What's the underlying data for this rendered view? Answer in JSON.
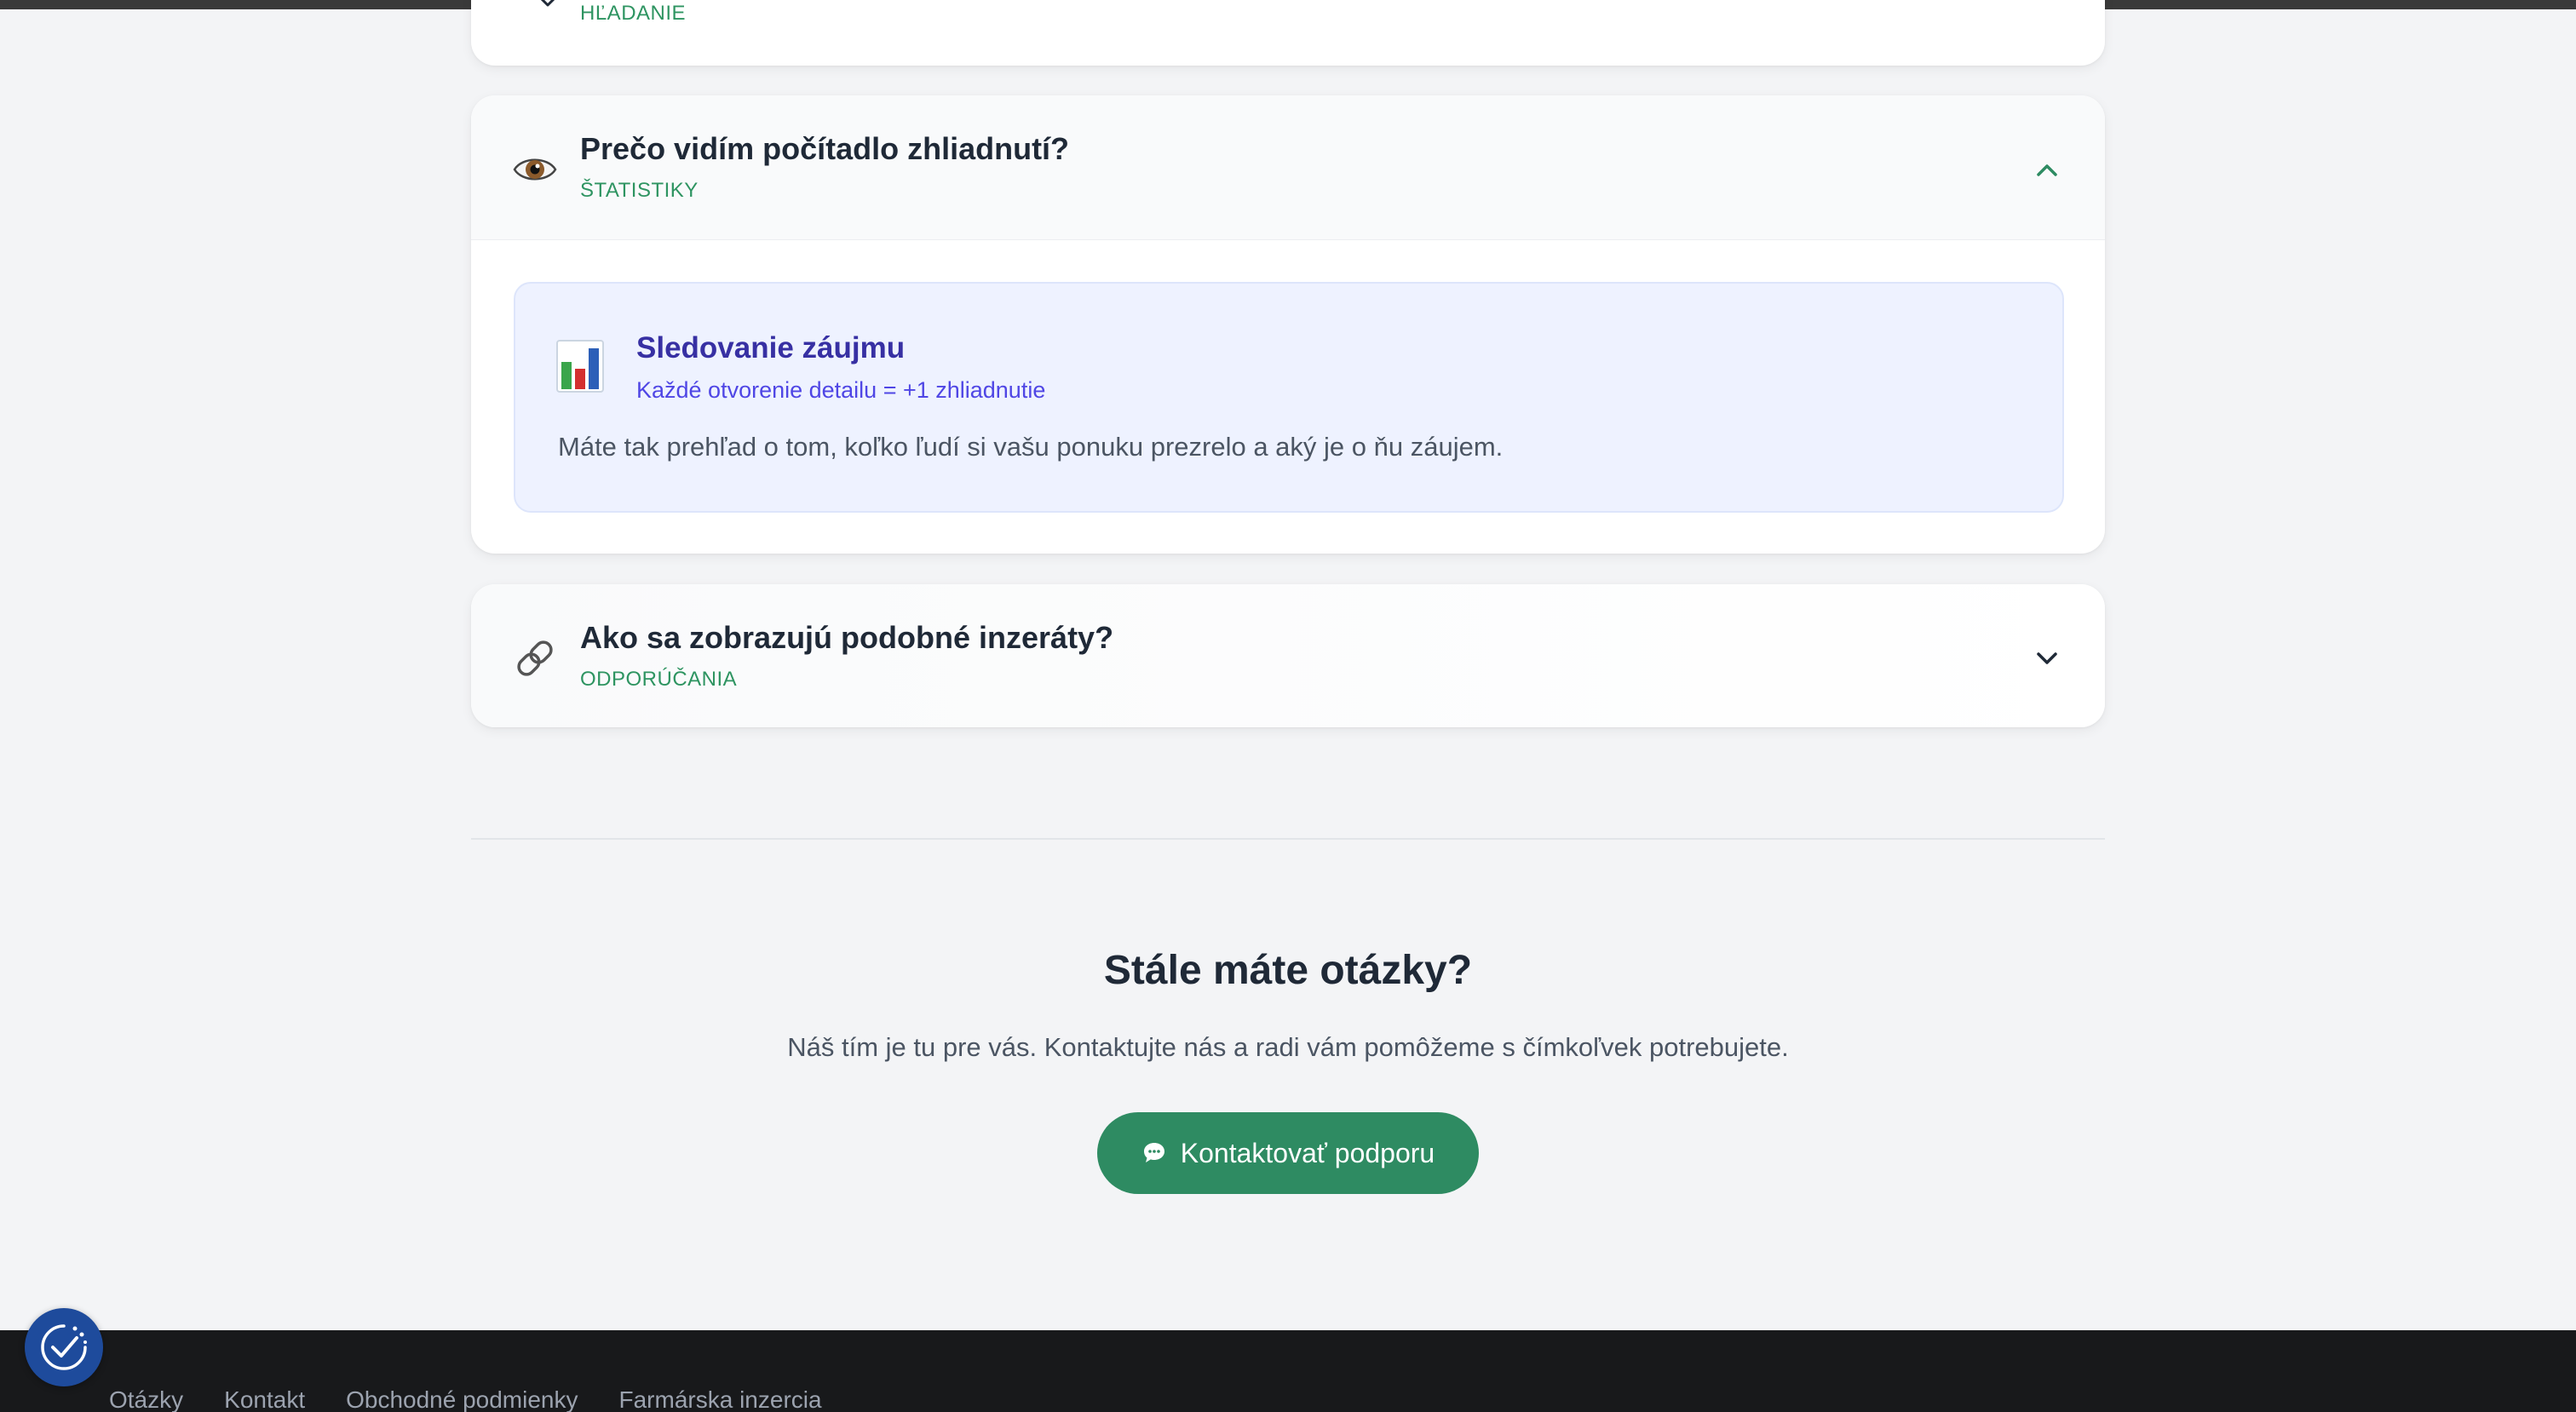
{
  "faq": {
    "previous": {
      "category": "HĽADANIE"
    },
    "open": {
      "question": "Prečo vidím počítadlo zhliadnutí?",
      "category": "ŠTATISTIKY",
      "icon": "eye-icon",
      "answer": {
        "icon": "bar-chart-icon",
        "title": "Sledovanie záujmu",
        "subtitle": "Každé otvorenie detailu = +1 zhliadnutie",
        "text": "Máte tak prehľad o tom, koľko ľudí si vašu ponuku prezrelo a aký je o ňu záujem."
      }
    },
    "closed": {
      "question": "Ako sa zobrazujú podobné inzeráty?",
      "category": "ODPORÚČANIA",
      "icon": "link-icon"
    }
  },
  "cta": {
    "title": "Stále máte otázky?",
    "text": "Náš tím je tu pre vás. Kontaktujte nás a radi vám pomôžeme s čímkoľvek potrebujete.",
    "button_label": "Kontaktovať podporu",
    "button_icon": "speech-bubble-icon"
  },
  "footer": {
    "links": [
      "Otázky",
      "Kontakt",
      "Obchodné podmienky",
      "Farmárska inzercia"
    ]
  },
  "colors": {
    "accent_green": "#2e8b62",
    "answer_bg": "#eef2ff",
    "answer_title": "#3730a3",
    "footer_bg": "#18191b",
    "a11y_button": "#1e4b9c"
  }
}
